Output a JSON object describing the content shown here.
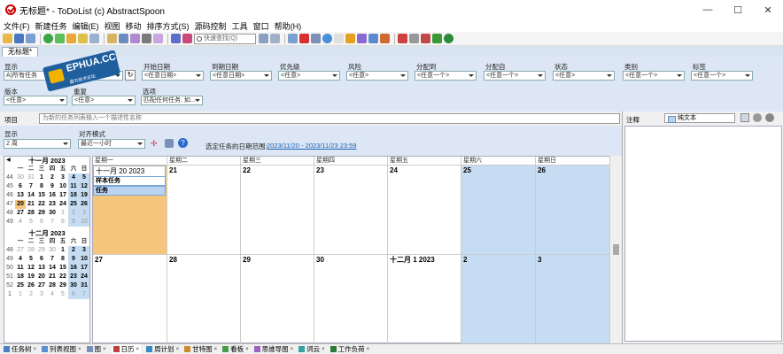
{
  "window": {
    "title": "无标题* - ToDoList (c) AbstractSpoon",
    "min": "—",
    "max": "☐",
    "close": "✕"
  },
  "menu": [
    "文件(F)",
    "新建任务",
    "编辑(E)",
    "视图",
    "移动",
    "排序方式(S)",
    "源码控制",
    "工具",
    "窗口",
    "帮助(H)"
  ],
  "toolbar": {
    "search_placeholder": "快速查找(Q)"
  },
  "tab": {
    "label": "无标题*"
  },
  "logo": {
    "text": "EPHUA.CC",
    "sub": "最为技术论坛"
  },
  "filters": {
    "show_label": "显示",
    "show_value": "A)所有任务",
    "start_label": "开始日期",
    "start_value": "<任意日期>",
    "due_label": "到期日期",
    "due_value": "<任意日期>",
    "priority_label": "优先级",
    "priority_value": "<任意>",
    "risk_label": "风险",
    "risk_value": "<任意>",
    "alloc_to_label": "分配到",
    "alloc_to_value": "<任意一个>",
    "alloc_by_label": "分配自",
    "alloc_by_value": "<任意一个>",
    "status_label": "状态",
    "status_value": "<任意>",
    "category_label": "类别",
    "category_value": "<任意一个>",
    "tags_label": "标签",
    "tags_value": "<任意一个>",
    "version_label": "版本",
    "version_value": "<任意>",
    "recurrence_label": "重复",
    "recurrence_value": "<任意>",
    "options_label": "选项",
    "options_value": "匹配任何任务, 如..."
  },
  "item": {
    "label": "项目",
    "placeholder": "为新的任务列表输入一个描述性名称"
  },
  "view": {
    "show_label": "显示",
    "show_value": "2 周",
    "align_label": "对齐模式",
    "align_value": "最近一小时",
    "range_label": "选定任务的日期范围:",
    "range_value": "2023/11/20 - 2023/11/23 23:59"
  },
  "minical": {
    "nov": {
      "title": "十一月 2023",
      "headers": [
        "一",
        "二",
        "三",
        "四",
        "五",
        "六",
        "日"
      ],
      "weeks": [
        {
          "wk": "44",
          "days": [
            "30",
            "31",
            "1",
            "2",
            "3",
            "4",
            "5"
          ]
        },
        {
          "wk": "45",
          "days": [
            "6",
            "7",
            "8",
            "9",
            "10",
            "11",
            "12"
          ]
        },
        {
          "wk": "46",
          "days": [
            "13",
            "14",
            "15",
            "16",
            "17",
            "18",
            "19"
          ]
        },
        {
          "wk": "47",
          "days": [
            "20",
            "21",
            "22",
            "23",
            "24",
            "25",
            "26"
          ]
        },
        {
          "wk": "48",
          "days": [
            "27",
            "28",
            "29",
            "30",
            "1",
            "2",
            "3"
          ]
        },
        {
          "wk": "49",
          "days": [
            "4",
            "5",
            "6",
            "7",
            "8",
            "9",
            "10"
          ]
        }
      ]
    },
    "dec": {
      "title": "十二月 2023",
      "headers": [
        "一",
        "二",
        "三",
        "四",
        "五",
        "六",
        "日"
      ],
      "weeks": [
        {
          "wk": "48",
          "days": [
            "27",
            "28",
            "29",
            "30",
            "1",
            "2",
            "3"
          ]
        },
        {
          "wk": "49",
          "days": [
            "4",
            "5",
            "6",
            "7",
            "8",
            "9",
            "10"
          ]
        },
        {
          "wk": "50",
          "days": [
            "11",
            "12",
            "13",
            "14",
            "15",
            "16",
            "17"
          ]
        },
        {
          "wk": "51",
          "days": [
            "18",
            "19",
            "20",
            "21",
            "22",
            "23",
            "24"
          ]
        },
        {
          "wk": "52",
          "days": [
            "25",
            "26",
            "27",
            "28",
            "29",
            "30",
            "31"
          ]
        },
        {
          "wk": "1",
          "days": [
            "1",
            "2",
            "3",
            "4",
            "5",
            "6",
            "7"
          ]
        }
      ]
    }
  },
  "week": {
    "days": [
      "星期一",
      "星期二",
      "星期三",
      "星期四",
      "星期五",
      "星期六",
      "星期日"
    ],
    "row1": [
      "十一月 20 2023",
      "21",
      "22",
      "23",
      "24",
      "25",
      "26"
    ],
    "row2": [
      "27",
      "28",
      "29",
      "30",
      "十二月 1 2023",
      "2",
      "3"
    ],
    "tasks": [
      "样本任务",
      "任务"
    ]
  },
  "bottom_tabs": [
    "任务树",
    "列表视图",
    "图",
    "日历",
    "周计划",
    "甘特图",
    "看板",
    "思维导图",
    "词云",
    "工作负荷"
  ],
  "comments": {
    "label": "注释",
    "format": "纯文本"
  },
  "colors": {
    "weekend": "#c6dcf2",
    "selected_day": "#f4c57a",
    "panel": "#dce6f4",
    "accent": "#1a5fb4"
  }
}
